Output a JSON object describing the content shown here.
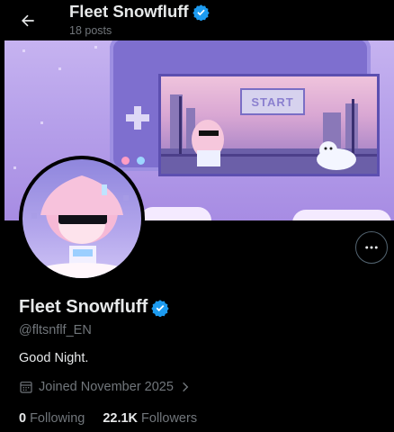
{
  "header": {
    "title": "Fleet Snowfluff",
    "post_count": "18 posts"
  },
  "banner": {
    "start_text": "START"
  },
  "profile": {
    "name": "Fleet Snowfluff",
    "handle": "@fltsnflf_EN",
    "bio": "Good Night.",
    "joined": "Joined November 2025",
    "following_count": "0",
    "following_label": "Following",
    "followers_count": "22.1K",
    "followers_label": "Followers",
    "verified": true
  },
  "colors": {
    "verified_badge": "#1d9bf0",
    "muted_text": "#71767b",
    "primary_text": "#e7e9ea",
    "background": "#000000"
  },
  "icons": [
    "back-arrow-icon",
    "verified-badge-icon",
    "more-options-icon",
    "calendar-icon",
    "chevron-right-icon"
  ]
}
